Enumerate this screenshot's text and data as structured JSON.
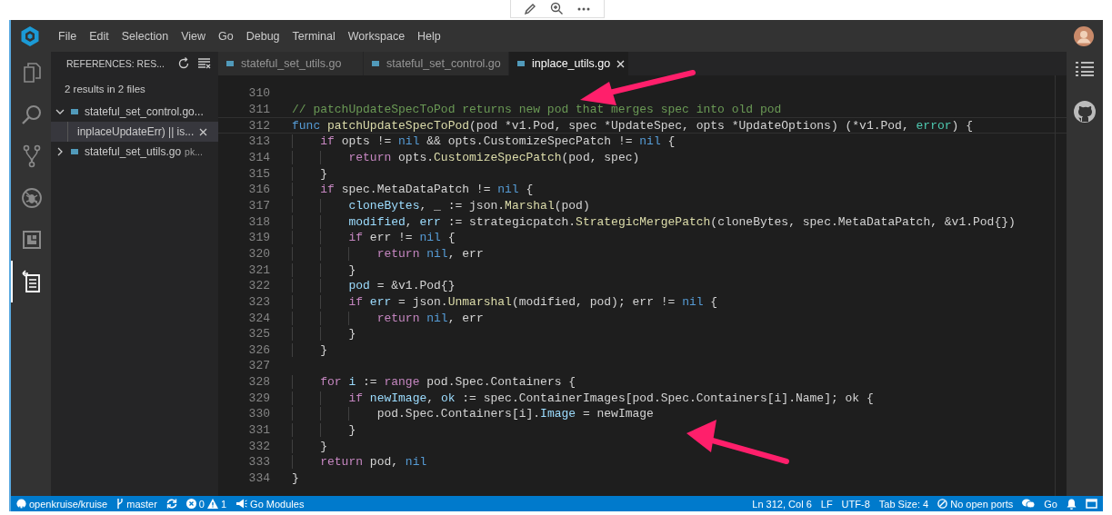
{
  "menu_bar": {
    "items": [
      "File",
      "Edit",
      "Selection",
      "View",
      "Go",
      "Debug",
      "Terminal",
      "Workspace",
      "Help"
    ]
  },
  "activity_bar": {
    "items": [
      {
        "kind": "files",
        "selected": false
      },
      {
        "kind": "search",
        "selected": false
      },
      {
        "kind": "scm",
        "selected": false
      },
      {
        "kind": "debug",
        "selected": false
      },
      {
        "kind": "extensions",
        "selected": false
      },
      {
        "kind": "references",
        "selected": true
      }
    ]
  },
  "sidebar": {
    "title": "REFERENCES: RES...",
    "summary": "2 results in 2 files",
    "files": [
      {
        "name": "stateful_set_control.go...",
        "expanded": true,
        "children": [
          {
            "text": "inplaceUpdateErr) || is...",
            "selected": true
          }
        ]
      },
      {
        "name": "stateful_set_utils.go",
        "description": "pk...",
        "expanded": false
      }
    ]
  },
  "tabs": [
    {
      "label": "stateful_set_utils.go",
      "selected": false
    },
    {
      "label": "stateful_set_control.go",
      "selected": false
    },
    {
      "label": "inplace_utils.go",
      "selected": true
    }
  ],
  "editor": {
    "lines": [
      {
        "number": "310",
        "current": false
      },
      {
        "number": "311",
        "current": false,
        "tokens": [
          {
            "kind": "comment",
            "text": "// patchUpdateSpecToPod returns new pod that merges spec into old pod"
          }
        ]
      },
      {
        "number": "312",
        "current": true,
        "tokens": [
          {
            "kind": "builtin",
            "text": "func"
          },
          {
            "kind": "function",
            "text": " patchUpdateSpecToPod"
          },
          {
            "kind": "plain",
            "text": "(pod *v1.Pod, spec *UpdateSpec, opts *UpdateOptions) (*v1.Pod, "
          },
          {
            "kind": "type",
            "text": "error"
          },
          {
            "kind": "plain",
            "text": ") {"
          }
        ]
      },
      {
        "number": "313",
        "current": false,
        "tokens": [
          {
            "kind": "keyword",
            "text": "    if"
          },
          {
            "kind": "plain",
            "text": " opts != "
          },
          {
            "kind": "builtin",
            "text": "nil"
          },
          {
            "kind": "plain",
            "text": " && opts.CustomizeSpecPatch != "
          },
          {
            "kind": "builtin",
            "text": "nil"
          },
          {
            "kind": "plain",
            "text": " {"
          }
        ]
      },
      {
        "number": "314",
        "current": false,
        "tokens": [
          {
            "kind": "keyword",
            "text": "        return"
          },
          {
            "kind": "plain",
            "text": " opts."
          },
          {
            "kind": "function",
            "text": "CustomizeSpecPatch"
          },
          {
            "kind": "plain",
            "text": "(pod, spec)"
          }
        ]
      },
      {
        "number": "315",
        "current": false,
        "tokens": [
          {
            "kind": "plain",
            "text": "    }"
          }
        ]
      },
      {
        "number": "316",
        "current": false,
        "tokens": [
          {
            "kind": "keyword",
            "text": "    if"
          },
          {
            "kind": "plain",
            "text": " spec.MetaDataPatch != "
          },
          {
            "kind": "builtin",
            "text": "nil"
          },
          {
            "kind": "plain",
            "text": " {"
          }
        ]
      },
      {
        "number": "317",
        "current": false,
        "tokens": [
          {
            "kind": "variable",
            "text": "        cloneBytes"
          },
          {
            "kind": "plain",
            "text": ", _ := json."
          },
          {
            "kind": "function",
            "text": "Marshal"
          },
          {
            "kind": "plain",
            "text": "(pod)"
          }
        ]
      },
      {
        "number": "318",
        "current": false,
        "tokens": [
          {
            "kind": "variable",
            "text": "        modified"
          },
          {
            "kind": "plain",
            "text": ", "
          },
          {
            "kind": "variable",
            "text": "err"
          },
          {
            "kind": "plain",
            "text": " := strategicpatch."
          },
          {
            "kind": "function",
            "text": "StrategicMergePatch"
          },
          {
            "kind": "plain",
            "text": "(cloneBytes, spec.MetaDataPatch, &v1.Pod{})"
          }
        ]
      },
      {
        "number": "319",
        "current": false,
        "tokens": [
          {
            "kind": "keyword",
            "text": "        if"
          },
          {
            "kind": "plain",
            "text": " err != "
          },
          {
            "kind": "builtin",
            "text": "nil"
          },
          {
            "kind": "plain",
            "text": " {"
          }
        ]
      },
      {
        "number": "320",
        "current": false,
        "tokens": [
          {
            "kind": "keyword",
            "text": "            return"
          },
          {
            "kind": "builtin",
            "text": " nil"
          },
          {
            "kind": "plain",
            "text": ", err"
          }
        ]
      },
      {
        "number": "321",
        "current": false,
        "tokens": [
          {
            "kind": "plain",
            "text": "        }"
          }
        ]
      },
      {
        "number": "322",
        "current": false,
        "tokens": [
          {
            "kind": "variable",
            "text": "        pod"
          },
          {
            "kind": "plain",
            "text": " = &v1.Pod{}"
          }
        ]
      },
      {
        "number": "323",
        "current": false,
        "tokens": [
          {
            "kind": "keyword",
            "text": "        if"
          },
          {
            "kind": "variable",
            "text": " err"
          },
          {
            "kind": "plain",
            "text": " = json."
          },
          {
            "kind": "function",
            "text": "Unmarshal"
          },
          {
            "kind": "plain",
            "text": "(modified, pod); err != "
          },
          {
            "kind": "builtin",
            "text": "nil"
          },
          {
            "kind": "plain",
            "text": " {"
          }
        ]
      },
      {
        "number": "324",
        "current": false,
        "tokens": [
          {
            "kind": "keyword",
            "text": "            return"
          },
          {
            "kind": "builtin",
            "text": " nil"
          },
          {
            "kind": "plain",
            "text": ", err"
          }
        ]
      },
      {
        "number": "325",
        "current": false,
        "tokens": [
          {
            "kind": "plain",
            "text": "        }"
          }
        ]
      },
      {
        "number": "326",
        "current": false,
        "tokens": [
          {
            "kind": "plain",
            "text": "    }"
          }
        ]
      },
      {
        "number": "327",
        "current": false
      },
      {
        "number": "328",
        "current": false,
        "tokens": [
          {
            "kind": "keyword",
            "text": "    for"
          },
          {
            "kind": "variable",
            "text": " i"
          },
          {
            "kind": "plain",
            "text": " := "
          },
          {
            "kind": "keyword",
            "text": "range"
          },
          {
            "kind": "plain",
            "text": " pod.Spec.Containers {"
          }
        ]
      },
      {
        "number": "329",
        "current": false,
        "tokens": [
          {
            "kind": "keyword",
            "text": "        if"
          },
          {
            "kind": "variable",
            "text": " newImage"
          },
          {
            "kind": "plain",
            "text": ", "
          },
          {
            "kind": "variable",
            "text": "ok"
          },
          {
            "kind": "plain",
            "text": " := spec.ContainerImages[pod.Spec.Containers[i].Name]; ok {"
          }
        ]
      },
      {
        "number": "330",
        "current": false,
        "tokens": [
          {
            "kind": "plain",
            "text": "            pod.Spec.Containers[i]."
          },
          {
            "kind": "variable",
            "text": "Image"
          },
          {
            "kind": "plain",
            "text": " = newImage"
          }
        ]
      },
      {
        "number": "331",
        "current": false,
        "tokens": [
          {
            "kind": "plain",
            "text": "        }"
          }
        ]
      },
      {
        "number": "332",
        "current": false,
        "tokens": [
          {
            "kind": "plain",
            "text": "    }"
          }
        ]
      },
      {
        "number": "333",
        "current": false,
        "tokens": [
          {
            "kind": "keyword",
            "text": "    return"
          },
          {
            "kind": "plain",
            "text": " pod, "
          },
          {
            "kind": "builtin",
            "text": "nil"
          }
        ]
      },
      {
        "number": "334",
        "current": false,
        "tokens": [
          {
            "kind": "plain",
            "text": "}"
          }
        ]
      }
    ]
  },
  "status_bar": {
    "left": [
      {
        "kind": "repo",
        "text": "openkruise/kruise"
      },
      {
        "kind": "branch",
        "text": "master"
      },
      {
        "kind": "sync"
      },
      {
        "kind": "problems",
        "errors": "0",
        "warnings": "1"
      },
      {
        "kind": "modules",
        "text": "Go Modules"
      }
    ],
    "right": [
      {
        "kind": "text",
        "text": "Ln 312, Col 6"
      },
      {
        "kind": "text",
        "text": "LF"
      },
      {
        "kind": "text",
        "text": "UTF-8"
      },
      {
        "kind": "text",
        "text": "Tab Size: 4"
      },
      {
        "kind": "ports",
        "text": "No open ports"
      },
      {
        "kind": "feedback"
      },
      {
        "kind": "text",
        "text": "Go"
      },
      {
        "kind": "bell"
      },
      {
        "kind": "layout"
      }
    ]
  }
}
